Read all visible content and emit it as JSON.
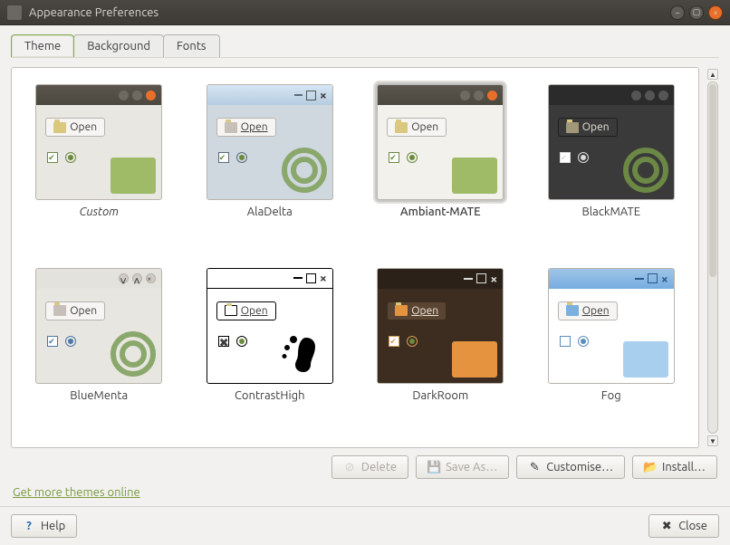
{
  "window": {
    "title": "Appearance Preferences"
  },
  "tabs": {
    "theme": "Theme",
    "background": "Background",
    "fonts": "Fonts"
  },
  "themes": [
    {
      "key": "custom",
      "label": "Custom",
      "italic": true
    },
    {
      "key": "aladelta",
      "label": "AlaDelta"
    },
    {
      "key": "ambiant",
      "label": "Ambiant-MATE",
      "selected": true
    },
    {
      "key": "blackmate",
      "label": "BlackMATE"
    },
    {
      "key": "bluementa",
      "label": "BlueMenta"
    },
    {
      "key": "contrasthigh",
      "label": "ContrastHigh"
    },
    {
      "key": "darkroom",
      "label": "DarkRoom"
    },
    {
      "key": "fog",
      "label": "Fog"
    }
  ],
  "thumb_text": {
    "open": "Open"
  },
  "actions": {
    "delete": "Delete",
    "save_as": "Save As…",
    "customise": "Customise…",
    "install": "Install…"
  },
  "link": "Get more themes online",
  "help": "Help",
  "close": "Close"
}
